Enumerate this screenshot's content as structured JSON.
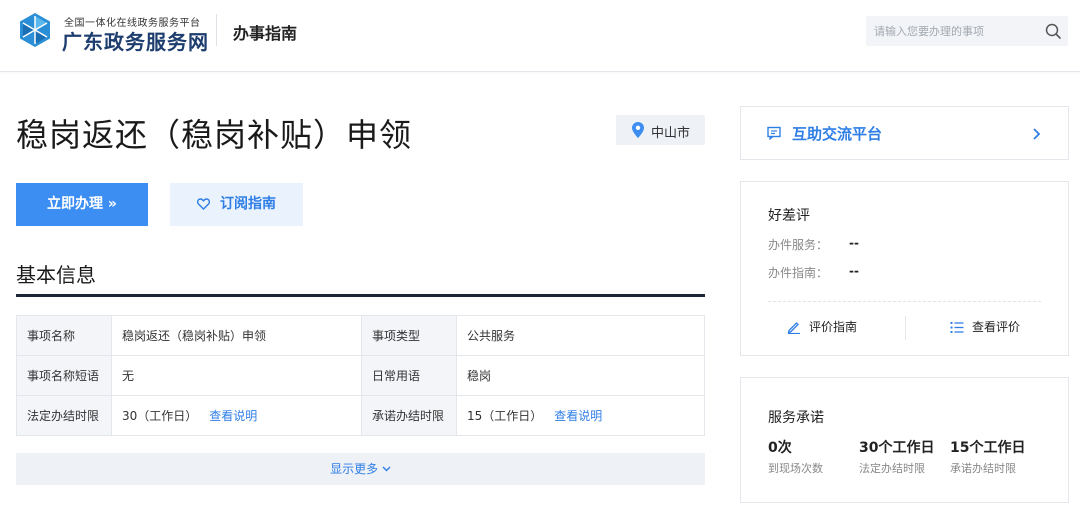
{
  "header": {
    "logo_small": "全国一体化在线政务服务平台",
    "logo_big": "广东政务服务网",
    "nav_label": "办事指南",
    "search_placeholder": "请输入您要办理的事项"
  },
  "page": {
    "title": "稳岗返还（稳岗补贴）申领",
    "region": "中山市",
    "primary_button": "立即办理 »",
    "secondary_button": "订阅指南"
  },
  "basic_info": {
    "section_title": "基本信息",
    "rows": [
      [
        {
          "label": "事项名称",
          "value": "稳岗返还（稳岗补贴）申领"
        },
        {
          "label": "事项类型",
          "value": "公共服务"
        }
      ],
      [
        {
          "label": "事项名称短语",
          "value": "无"
        },
        {
          "label": "日常用语",
          "value": "稳岗"
        }
      ],
      [
        {
          "label": "法定办结时限",
          "value": "30（工作日）",
          "link": "查看说明"
        },
        {
          "label": "承诺办结时限",
          "value": "15（工作日）",
          "link": "查看说明"
        }
      ]
    ],
    "show_more": "显示更多"
  },
  "sidebar": {
    "exchange_label": "互助交流平台",
    "rating": {
      "title": "好差评",
      "items": [
        {
          "label": "办件服务：",
          "value": "--"
        },
        {
          "label": "办件指南：",
          "value": "--"
        }
      ],
      "evaluate_button": "评价指南",
      "view_button": "查看评价"
    },
    "promise": {
      "title": "服务承诺",
      "items": [
        {
          "value": "0次",
          "label": "到现场次数"
        },
        {
          "value": "30个工作日",
          "label": "法定办结时限"
        },
        {
          "value": "15个工作日",
          "label": "承诺办结时限"
        }
      ]
    }
  },
  "colors": {
    "accent": "#3d8ef3",
    "link": "#2f7ee6",
    "brand_dark": "#1d3d6e",
    "section_underline": "#1b2637"
  }
}
